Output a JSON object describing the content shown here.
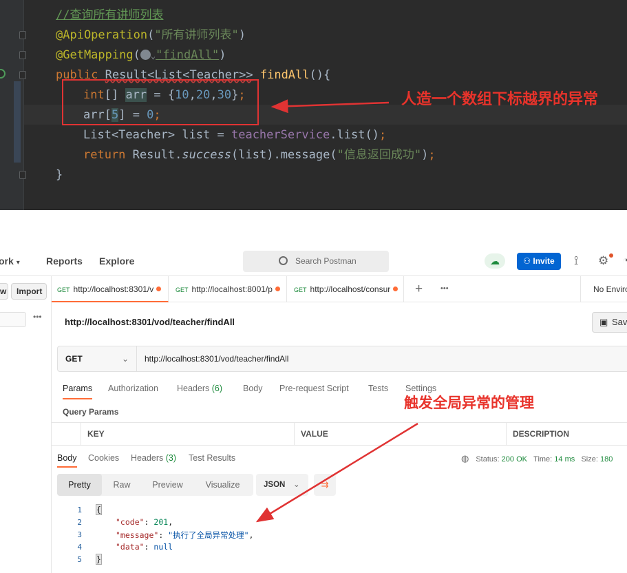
{
  "ide": {
    "comment": "//查询所有讲师列表",
    "annotation1": "@ApiOperation",
    "annotation1_arg": "\"所有讲师列表\"",
    "annotation2": "@GetMapping",
    "annotation2_arg": "\"findAll\"",
    "kw_public": "public",
    "return_type": "Result<List<Teacher>>",
    "method_name": "findAll",
    "line4_kw": "int",
    "line4_var": "arr",
    "line4_vals": [
      "10",
      "20",
      "30"
    ],
    "line5_var": "arr",
    "line5_idx": "5",
    "line5_val": "0",
    "line6_type": "List<Teacher>",
    "line6_var": "list",
    "line6_field": "teacherService",
    "line6_call": "list",
    "line7_kw": "return",
    "line7_result": "Result",
    "line7_success": "success",
    "line7_arg": "list",
    "line7_message": "message",
    "line7_str": "\"信息返回成功\"",
    "close_brace": "}"
  },
  "annotations": {
    "note1": "人造一个数组下标越界的异常",
    "note2": "触发全局异常的管理"
  },
  "postman": {
    "nav": {
      "workspace_partial": "ork",
      "reports": "Reports",
      "explore": "Explore"
    },
    "search_placeholder": "Search Postman",
    "invite": "Invite",
    "sidebar": {
      "new_partial": "w",
      "import": "Import"
    },
    "tabs": [
      {
        "method": "GET",
        "url": "http://localhost:8301/v"
      },
      {
        "method": "GET",
        "url": "http://localhost:8001/p"
      },
      {
        "method": "GET",
        "url": "http://localhost/consur"
      }
    ],
    "environment": "No Enviro",
    "request_title": "http://localhost:8301/vod/teacher/findAll",
    "save": "Sav",
    "method": "GET",
    "url": "http://localhost:8301/vod/teacher/findAll",
    "request_tabs": [
      "Params",
      "Authorization",
      "Headers",
      "Body",
      "Pre-request Script",
      "Tests",
      "Settings"
    ],
    "headers_count": "(6)",
    "query_params": "Query Params",
    "kv_headers": [
      "KEY",
      "VALUE",
      "DESCRIPTION"
    ],
    "response_tabs": [
      "Body",
      "Cookies",
      "Headers",
      "Test Results"
    ],
    "resp_headers_count": "(3)",
    "status_label": "Status:",
    "status_value": "200 OK",
    "time_label": "Time:",
    "time_value": "14 ms",
    "size_label": "Size:",
    "size_value": "180",
    "view_tabs": [
      "Pretty",
      "Raw",
      "Preview",
      "Visualize"
    ],
    "format": "JSON",
    "line_numbers": [
      "1",
      "2",
      "3",
      "4",
      "5"
    ],
    "json": {
      "code_key": "\"code\"",
      "code_val": "201",
      "message_key": "\"message\"",
      "message_val": "\"执行了全局异常处理\"",
      "data_key": "\"data\"",
      "data_val": "null"
    }
  },
  "colors": {
    "accent": "#ff6c37",
    "annotation_red": "#e8332b",
    "invite_blue": "#0265d2",
    "ide_bg": "#2b2b2b"
  }
}
